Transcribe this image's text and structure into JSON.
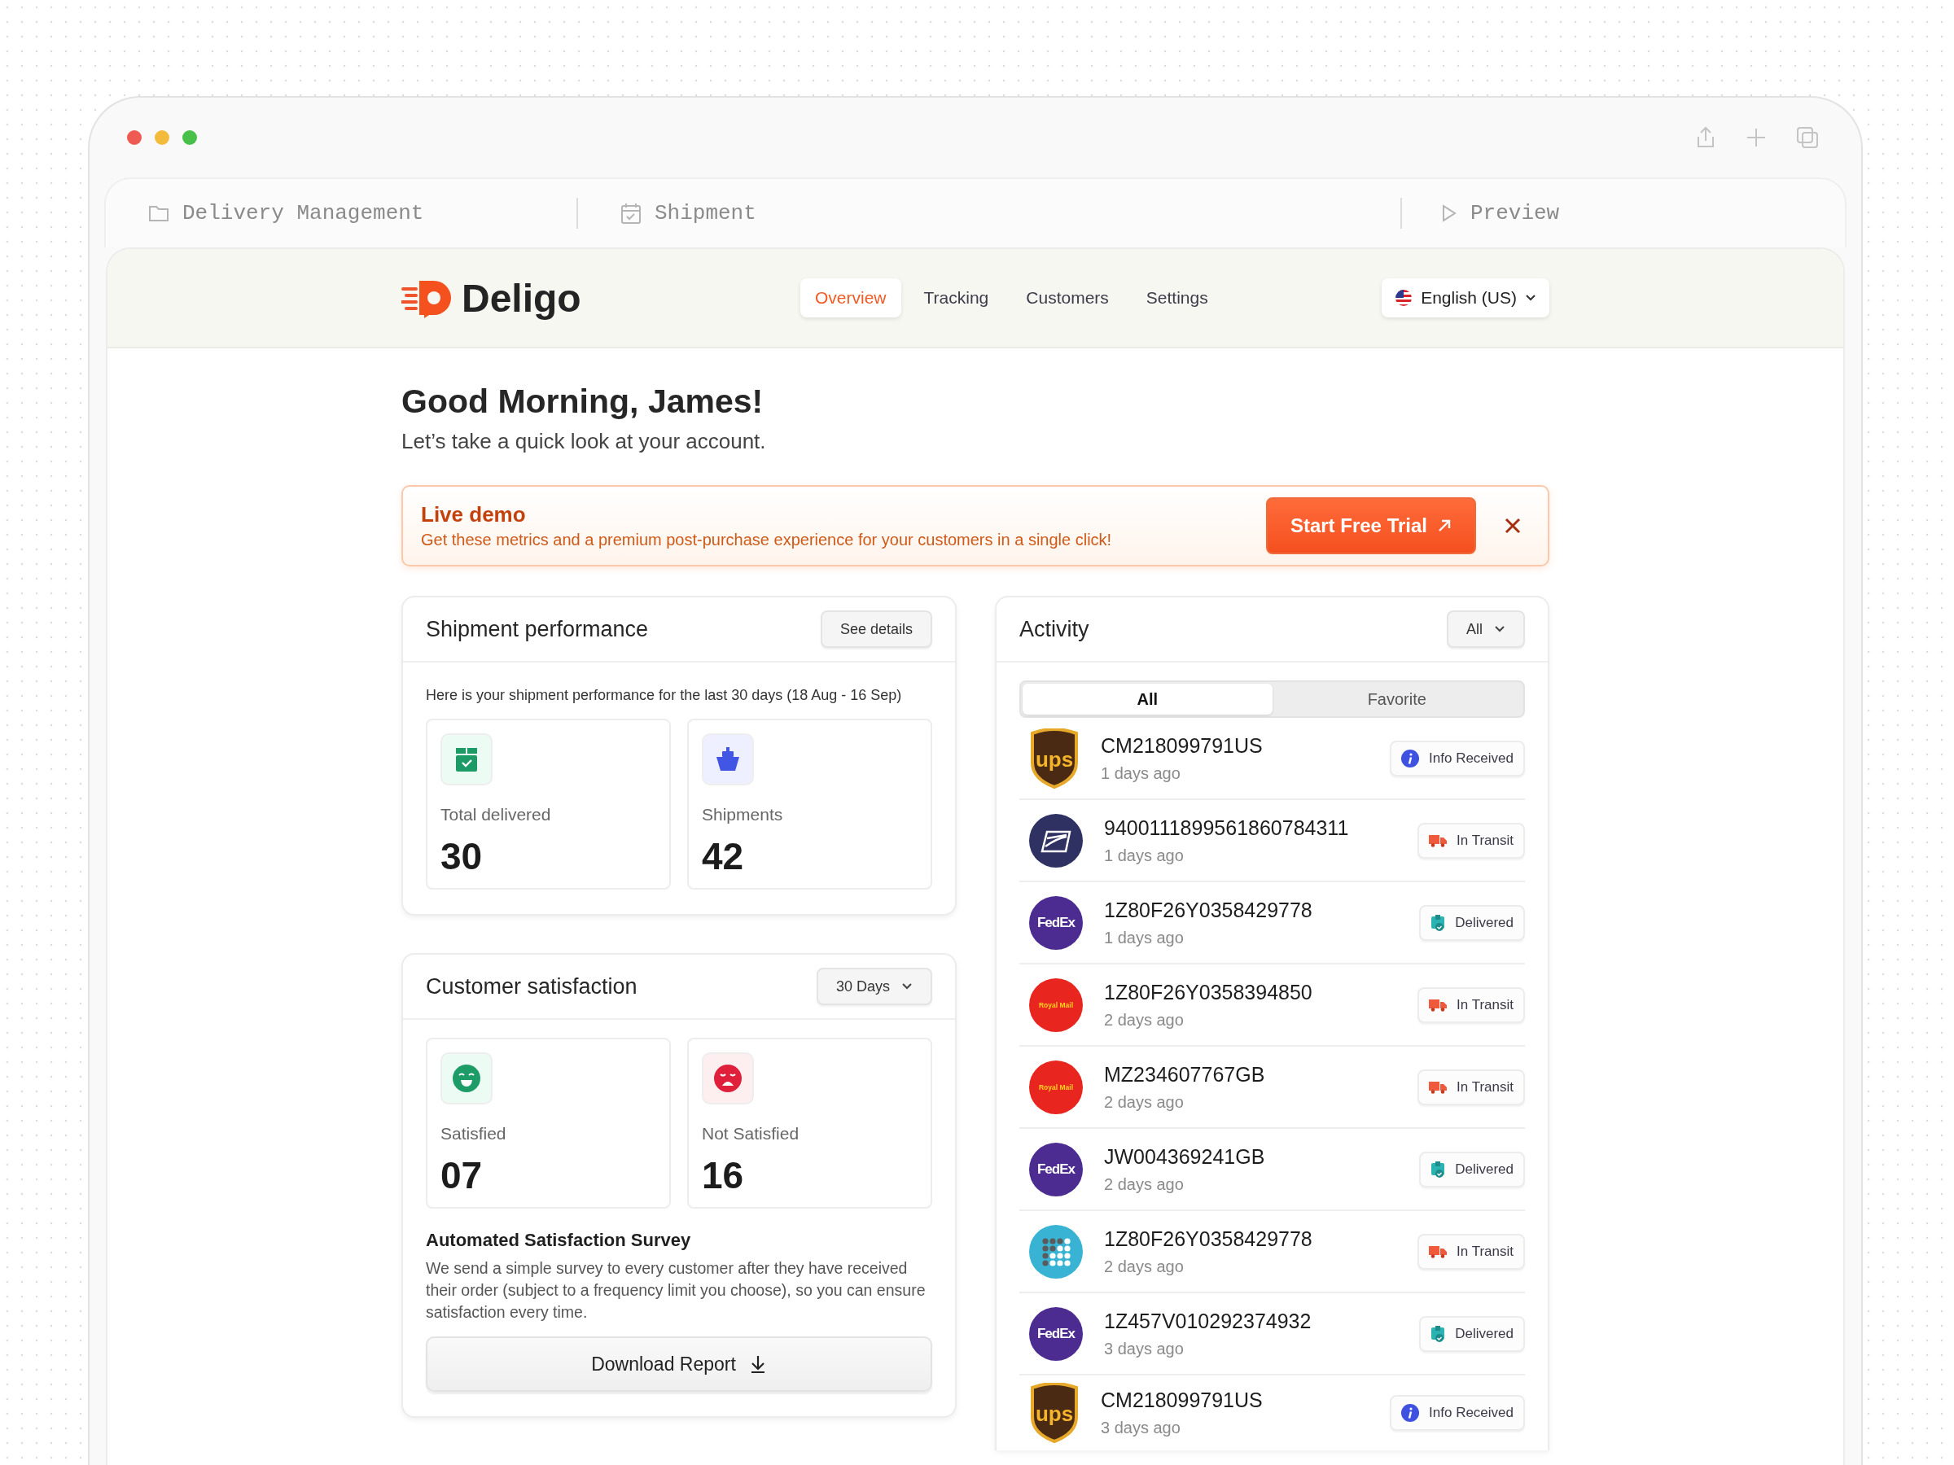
{
  "browser": {
    "tabs": [
      {
        "label": "Delivery Management"
      },
      {
        "label": "Shipment"
      },
      {
        "label": "Preview"
      }
    ]
  },
  "header": {
    "brand": "Deligo",
    "nav": [
      {
        "label": "Overview",
        "selected": true
      },
      {
        "label": "Tracking",
        "selected": false
      },
      {
        "label": "Customers",
        "selected": false
      },
      {
        "label": "Settings",
        "selected": false
      }
    ],
    "language": "English (US)"
  },
  "greeting": {
    "title": "Good Morning, James!",
    "subtitle": "Let’s take a quick look at your account."
  },
  "banner": {
    "title": "Live demo",
    "text": "Get these metrics and a premium post-purchase experience for your customers in a single click!",
    "button": "Start Free Trial"
  },
  "shipment_performance": {
    "title": "Shipment performance",
    "button": "See details",
    "description": "Here is your shipment performance for the last 30 days (18 Aug - 16 Sep)",
    "stats": [
      {
        "label": "Total delivered",
        "value": "30"
      },
      {
        "label": "Shipments",
        "value": "42"
      }
    ]
  },
  "customer_satisfaction": {
    "title": "Customer satisfaction",
    "range": "30 Days",
    "stats": [
      {
        "label": "Satisfied",
        "value": "07"
      },
      {
        "label": "Not Satisfied",
        "value": "16"
      }
    ],
    "survey_title": "Automated Satisfaction Survey",
    "survey_text": "We send a simple survey to every customer after they have received their order (subject to a frequency limit you choose), so you can ensure satisfaction every time.",
    "button": "Download Report"
  },
  "activity": {
    "title": "Activity",
    "filter": "All",
    "segments": [
      {
        "label": "All",
        "selected": true
      },
      {
        "label": "Favorite",
        "selected": false
      }
    ],
    "items": [
      {
        "kind": "shield",
        "logo_text": "ups",
        "color": "#4a2a12",
        "tracking": "CM218099791US",
        "time": "1 days ago",
        "status": {
          "kind": "info",
          "label": "Info Received"
        }
      },
      {
        "kind": "eagle",
        "color": "#2f3163",
        "tracking": "9400111899561860784311",
        "time": "1 days ago",
        "status": {
          "kind": "transit",
          "label": "In Transit"
        }
      },
      {
        "kind": "wordmark",
        "logo_text": "FedEx",
        "color": "#4d2c91",
        "tracking": "1Z80F26Y0358429778",
        "time": "1 days ago",
        "status": {
          "kind": "delivered",
          "label": "Delivered"
        }
      },
      {
        "kind": "script",
        "logo_text": "Royal Mail",
        "color": "#e8261f",
        "tracking": "1Z80F26Y0358394850",
        "time": "2 days ago",
        "status": {
          "kind": "transit",
          "label": "In Transit"
        }
      },
      {
        "kind": "script",
        "logo_text": "Royal Mail",
        "color": "#e8261f",
        "tracking": "MZ234607767GB",
        "time": "2 days ago",
        "status": {
          "kind": "transit",
          "label": "In Transit"
        }
      },
      {
        "kind": "wordmark",
        "logo_text": "FedEx",
        "color": "#4d2c91",
        "tracking": "JW004369241GB",
        "time": "2 days ago",
        "status": {
          "kind": "delivered",
          "label": "Delivered"
        }
      },
      {
        "kind": "dots",
        "color": "#38b3d3",
        "tracking": "1Z80F26Y0358429778",
        "time": "2 days ago",
        "status": {
          "kind": "transit",
          "label": "In Transit"
        }
      },
      {
        "kind": "wordmark",
        "logo_text": "FedEx",
        "color": "#4d2c91",
        "tracking": "1Z457V010292374932",
        "time": "3 days ago",
        "status": {
          "kind": "delivered",
          "label": "Delivered"
        }
      },
      {
        "kind": "shield",
        "logo_text": "ups",
        "color": "#4a2a12",
        "tracking": "CM218099791US",
        "time": "3 days ago",
        "status": {
          "kind": "info",
          "label": "Info Received"
        }
      }
    ]
  }
}
